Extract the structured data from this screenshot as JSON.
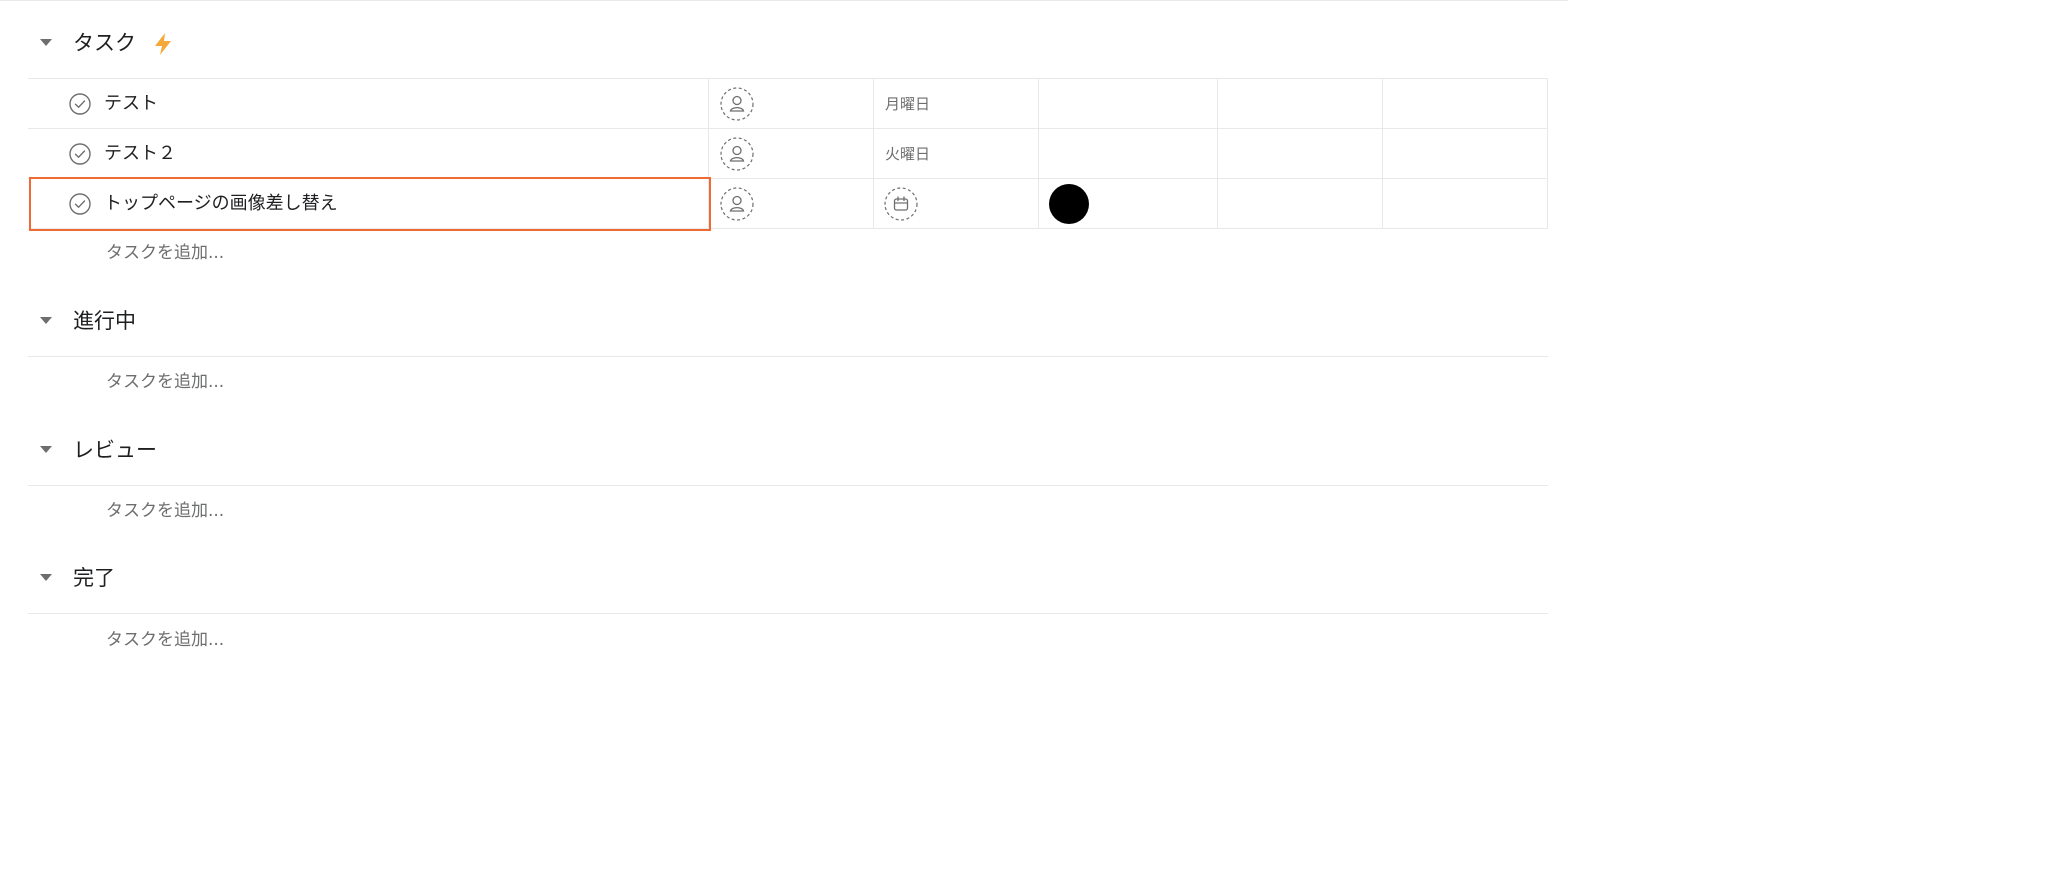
{
  "sections": [
    {
      "title": "タスク",
      "has_rule_icon": true
    },
    {
      "title": "進行中"
    },
    {
      "title": "レビュー"
    },
    {
      "title": "完了"
    }
  ],
  "tasks": [
    {
      "name": "テスト",
      "due": "月曜日"
    },
    {
      "name": "テスト２",
      "due": "火曜日"
    },
    {
      "name": "トップページの画像差し替え",
      "due": "",
      "selected": true
    }
  ],
  "add_task_label": "タスクを追加...",
  "colors": {
    "accent_selected": "#f06a35",
    "rule_bolt": "#f5a93b",
    "divider": "#e8e8e8",
    "muted_text": "#6d6e6f"
  },
  "icons": {
    "complete": "check-circle-icon",
    "assignee": "person-placeholder-icon",
    "due_date": "calendar-icon",
    "rule": "lightning-bolt-icon",
    "collapse": "caret-down-icon"
  }
}
